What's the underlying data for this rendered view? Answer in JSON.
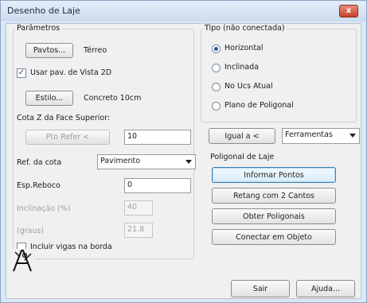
{
  "window": {
    "title": "Desenho de Laje",
    "close_label": "x"
  },
  "params": {
    "legend": "Parâmetros",
    "pavtos_button": "Pavtos...",
    "pavtos_value": "Térreo",
    "use_view_checkbox": "Usar pav. de Vista 2D",
    "use_view_checked": true,
    "estilo_button": "Estilo...",
    "estilo_value": "Concreto 10cm",
    "cota_label": "Cota Z da Face Superior:",
    "pto_button": "Pto Refer <",
    "cota_value": "10",
    "ref_label": "Ref. da cota",
    "ref_value": "Pavimento",
    "reboco_label": "Esp.Reboco",
    "reboco_value": "0",
    "inclinacao_label": "Inclinação (%)",
    "inclinacao_value": "40",
    "graus_label": "(graus)",
    "graus_value": "21.8",
    "incluir_checkbox": "Incluir vigas na borda",
    "incluir_checked": false
  },
  "tipo": {
    "legend": "Tipo (não conectada)",
    "options": [
      "Horizontal",
      "Inclinada",
      "No Ucs Atual",
      "Plano de Poligonal"
    ],
    "selected": "Horizontal"
  },
  "tools": {
    "igual_button": "Igual a <",
    "ferramentas_value": "Ferramentas"
  },
  "poligonal": {
    "label": "Poligonal de Laje",
    "buttons": [
      "Informar Pontos",
      "Retang com 2 Cantos",
      "Obter Poligonais",
      "Conectar em Objeto"
    ]
  },
  "footer": {
    "sair_button": "Sair",
    "ajuda_button": "Ajuda..."
  }
}
